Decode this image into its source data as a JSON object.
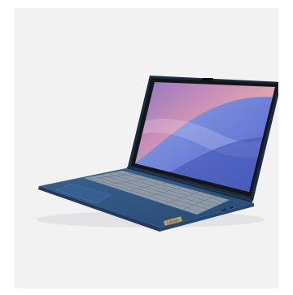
{
  "product": {
    "brand_logo_text": "Lenovo",
    "colors": {
      "chassis": "#2f5580",
      "chassis_shadow": "#1e3b5e",
      "bezel": "#121619",
      "card_background": "#f2f2f3"
    }
  }
}
